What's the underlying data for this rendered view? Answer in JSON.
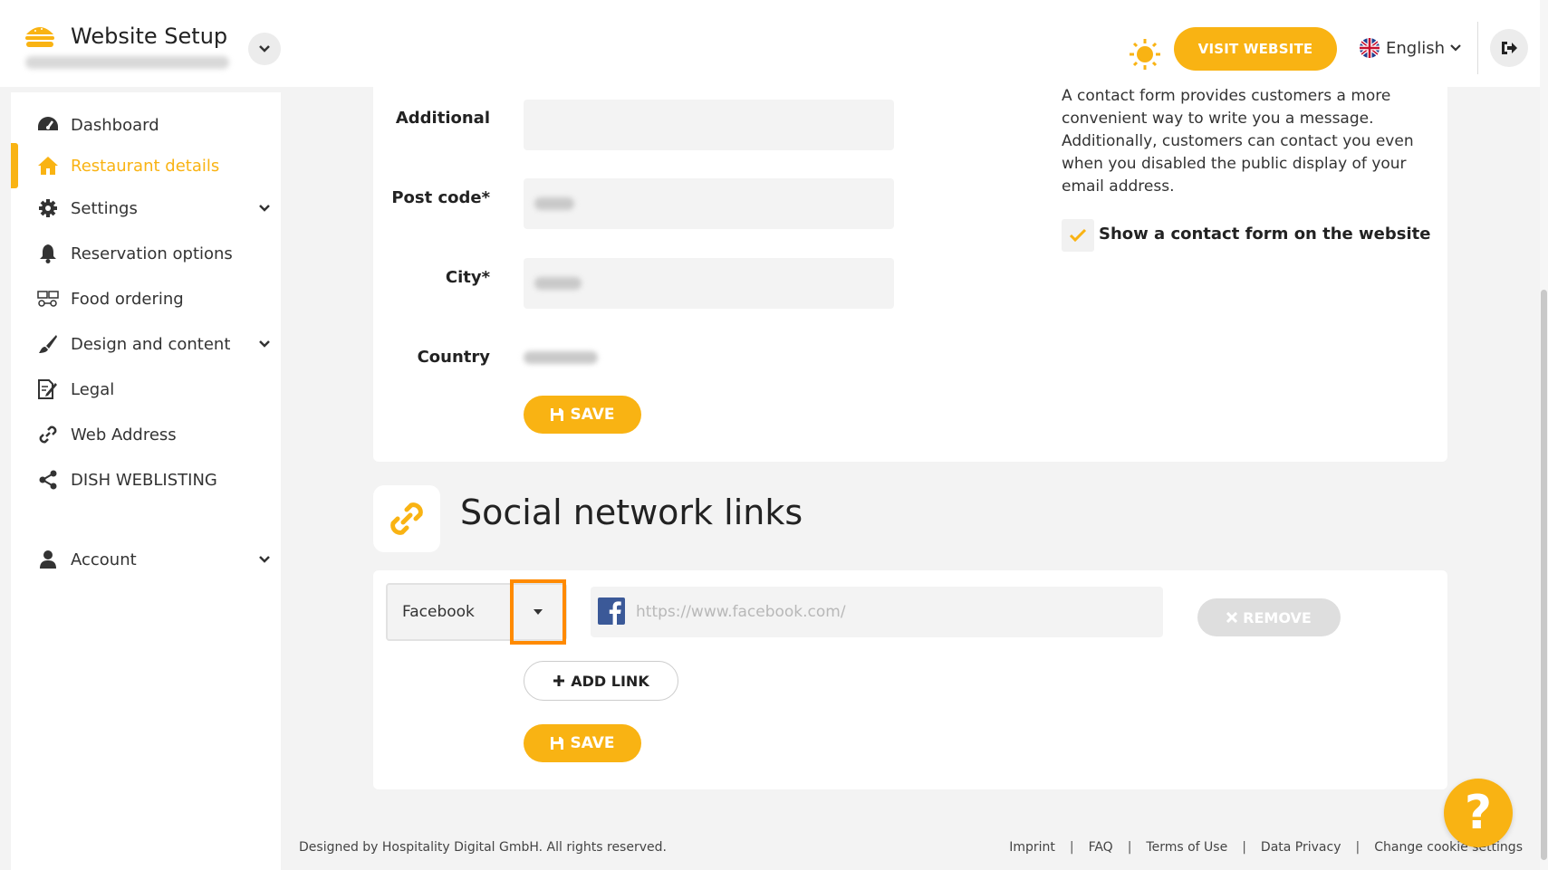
{
  "header": {
    "app_title": "Website Setup",
    "visit_website": "VISIT WEBSITE",
    "language": "English"
  },
  "sidebar": {
    "items": [
      {
        "label": "Dashboard",
        "icon": "dashboard-icon"
      },
      {
        "label": "Restaurant details",
        "icon": "home-icon",
        "active": true
      },
      {
        "label": "Settings",
        "icon": "gear-icon",
        "expandable": true
      },
      {
        "label": "Reservation options",
        "icon": "bell-icon"
      },
      {
        "label": "Food ordering",
        "icon": "food-ordering-icon"
      },
      {
        "label": "Design and content",
        "icon": "brush-icon",
        "expandable": true
      },
      {
        "label": "Legal",
        "icon": "legal-icon"
      },
      {
        "label": "Web Address",
        "icon": "link-icon"
      },
      {
        "label": "DISH WEBLISTING",
        "icon": "share-icon"
      },
      {
        "label": "Account",
        "icon": "user-icon",
        "expandable": true
      }
    ]
  },
  "address_form": {
    "additional_label": "Additional",
    "postcode_label": "Post code*",
    "city_label": "City*",
    "country_label": "Country",
    "save_label": "SAVE"
  },
  "contact": {
    "description": "A contact form provides customers a more convenient way to write you a message. Additionally, customers can contact you even when you disabled the public display of your email address.",
    "checkbox_label": "Show a contact form on the website",
    "checked": true
  },
  "social": {
    "title": "Social network links",
    "network_value": "Facebook",
    "url_placeholder": "https://www.facebook.com/",
    "remove_label": "REMOVE",
    "add_link_label": "ADD LINK",
    "save_label": "SAVE"
  },
  "footer": {
    "copyright": "Designed by Hospitality Digital GmbH. All rights reserved.",
    "links": [
      "Imprint",
      "FAQ",
      "Terms of Use",
      "Data Privacy",
      "Change cookie settings"
    ]
  },
  "colors": {
    "accent": "#f9b313",
    "highlight": "#ff8a00",
    "facebook": "#3b5998"
  }
}
